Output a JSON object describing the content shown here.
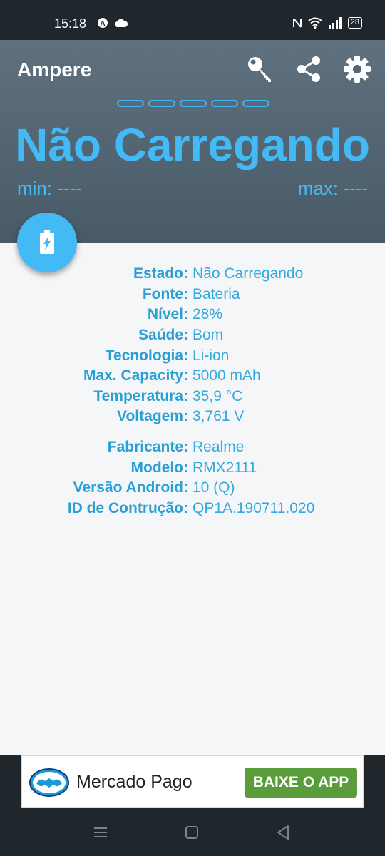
{
  "status_bar": {
    "time": "15:18",
    "battery": "28",
    "icons": [
      "a-circle-icon",
      "cloud-icon",
      "nfc-icon",
      "wifi-icon",
      "signal-icon",
      "battery-icon"
    ]
  },
  "appbar": {
    "title": "Ampere",
    "actions": [
      "key-icon",
      "share-icon",
      "settings-icon"
    ]
  },
  "status": {
    "title": "Não Carregando",
    "min": "min: ----",
    "max": "max: ----",
    "accent": "#43b9f5"
  },
  "battery_info": [
    {
      "label": "Estado:",
      "value": "Não Carregando"
    },
    {
      "label": "Fonte:",
      "value": "Bateria"
    },
    {
      "label": "Nível:",
      "value": "28%"
    },
    {
      "label": "Saúde:",
      "value": "Bom"
    },
    {
      "label": "Tecnologia:",
      "value": "Li-ion"
    },
    {
      "label": "Max. Capacity:",
      "value": "5000 mAh"
    },
    {
      "label": "Temperatura:",
      "value": "35,9 °C"
    },
    {
      "label": "Voltagem:",
      "value": "3,761 V"
    }
  ],
  "device_info": [
    {
      "label": "Fabricante:",
      "value": "Realme"
    },
    {
      "label": "Modelo:",
      "value": "RMX2111"
    },
    {
      "label": "Versão Android:",
      "value": "10 (Q)"
    },
    {
      "label": "ID de Contrução:",
      "value": "QP1A.190711.020"
    }
  ],
  "ad": {
    "brand": "Mercado Pago",
    "cta": "BAIXE O APP",
    "cta_color": "#5a9b3a"
  }
}
